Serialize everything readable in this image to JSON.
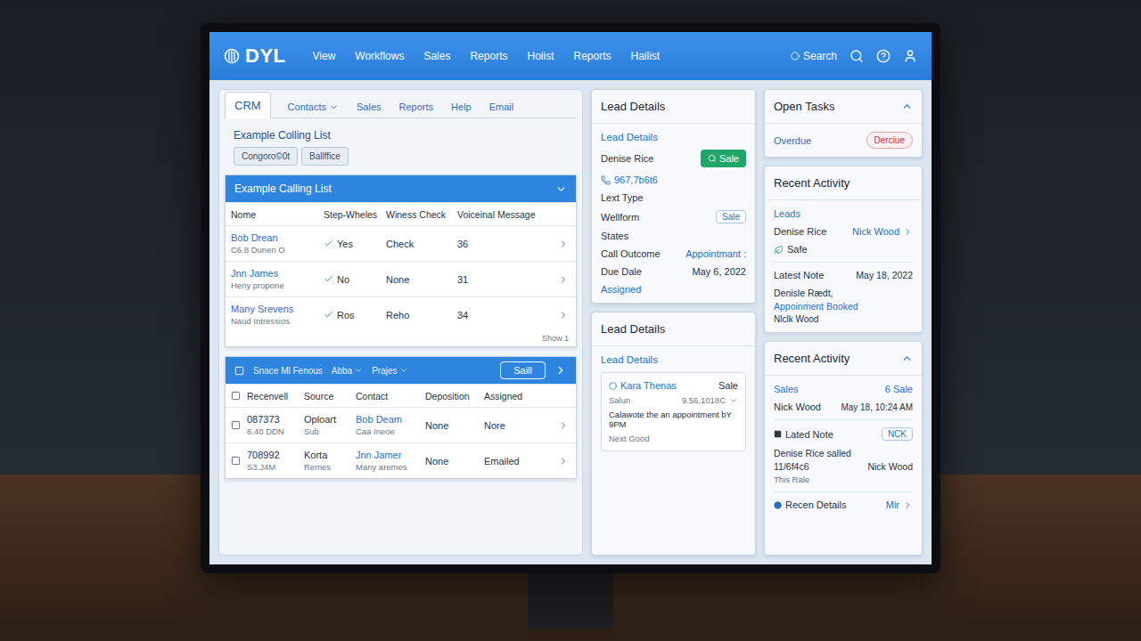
{
  "topbar": {
    "logo": "DYL",
    "nav": [
      "View",
      "Workflows",
      "Sales",
      "Reports",
      "Hoiist",
      "Reports",
      "Hailist"
    ],
    "search": "Search"
  },
  "subtabs": [
    {
      "label": "CRM",
      "selected": true,
      "dropdown": false
    },
    {
      "label": "Contacts",
      "selected": false,
      "dropdown": true
    },
    {
      "label": "Sales",
      "selected": false,
      "dropdown": false
    },
    {
      "label": "Reports",
      "selected": false,
      "dropdown": false
    },
    {
      "label": "Help",
      "selected": false,
      "dropdown": false
    },
    {
      "label": "Email",
      "selected": false,
      "dropdown": false
    }
  ],
  "calling_list": {
    "title": "Example Colling List",
    "buttons": [
      "Congoro©0t",
      "Ballffice"
    ],
    "header": "Example Calling List",
    "expanded": true,
    "columns": [
      "Nome",
      "Step-Wheles",
      "Winess Check",
      "Voiceinal Message"
    ],
    "rows": [
      {
        "name": "Bob Drean",
        "sub": "C6.8 Dunen O",
        "checked": true,
        "step": "Yes",
        "check": "Check",
        "voicemail": "36"
      },
      {
        "name": "Jnn James",
        "sub": "Heny propone",
        "checked": true,
        "step": "No",
        "check": "None",
        "voicemail": "31"
      },
      {
        "name": "Many Srevens",
        "sub": "Naud Intressios",
        "checked": true,
        "step": "Ros",
        "check": "Reho",
        "voicemail": "34"
      }
    ],
    "footer": "Show 1"
  },
  "lead_table": {
    "label": "Snace Ml Fenous",
    "all_selected": false,
    "filters": [
      "Abba",
      "Prajes"
    ],
    "button": "Saill",
    "columns": [
      "Recenvell",
      "Source",
      "Contact",
      "Deposition",
      "Assigned"
    ],
    "rows": [
      {
        "selected": false,
        "id": "087373",
        "id_sub": "6.40 DDN",
        "source": "Oploart",
        "source_sub": "Sub",
        "contact": "Bob Deam",
        "contact_sub": "Caa Ineoe",
        "deposition": "None",
        "assigned": "Nore"
      },
      {
        "selected": false,
        "id": "708992",
        "id_sub": "S3.J4M",
        "source": "Korta",
        "source_sub": "Remes",
        "contact": "Jnn Jamer",
        "contact_sub": "Many aremes",
        "deposition": "None",
        "assigned": "Emailed"
      }
    ]
  },
  "lead_details": {
    "title": "Lead Details",
    "subtitle": "Lead Details",
    "name": "Denise Rice",
    "action": "Sale",
    "phone": "967,7b6t6",
    "fields": [
      {
        "label": "Lext Type",
        "value": null,
        "kind": "label"
      },
      {
        "label": "Wellform",
        "value": "Sale",
        "kind": "badge"
      },
      {
        "label": "States",
        "value": null,
        "kind": "label"
      },
      {
        "label": "Call Outcome",
        "value": "Appointmant :",
        "kind": "link"
      },
      {
        "label": "Due Dale",
        "value": "May 6, 2022",
        "kind": "value"
      },
      {
        "label": "Assigned",
        "value": null,
        "kind": "link-label"
      }
    ]
  },
  "lead_details_2": {
    "title": "Lead Details",
    "subtitle": "Lead Details",
    "name": "Kara Thenas",
    "status": "Sale",
    "sub": "Salun",
    "amount": "9.56,1018C",
    "note": "Calawote the an appointment bY 9PM",
    "footer": "Next Good"
  },
  "open_tasks": {
    "title": "Open Tasks",
    "expanded": true,
    "label": "Overdue",
    "badge": "Derciue"
  },
  "recent_activity": {
    "title": "Recent Activity",
    "section": "Leads",
    "name": "Denise Rice",
    "owner": "Nick Wood",
    "status": "Safe",
    "note_label": "Latest Note",
    "note_date": "May 18, 2022",
    "note_text": "Denisle Rædt,",
    "note_link": "Appoinment Booked",
    "note_author": "Nlclk Wood"
  },
  "recent_activity_2": {
    "title": "Recent Activity",
    "expanded": true,
    "section": "Sales",
    "count": "6 Sale",
    "name": "Nick Wood",
    "time": "May 18, 10:24 AM",
    "note_label": "Lated Note",
    "note_badge": "NCK",
    "note_text": "Denise Rice salled",
    "note_code": "11/6f4c6",
    "note_author": "Nick Wood",
    "note_extra": "This Rale",
    "details_label": "Recen Details",
    "details_link": "Mir"
  }
}
